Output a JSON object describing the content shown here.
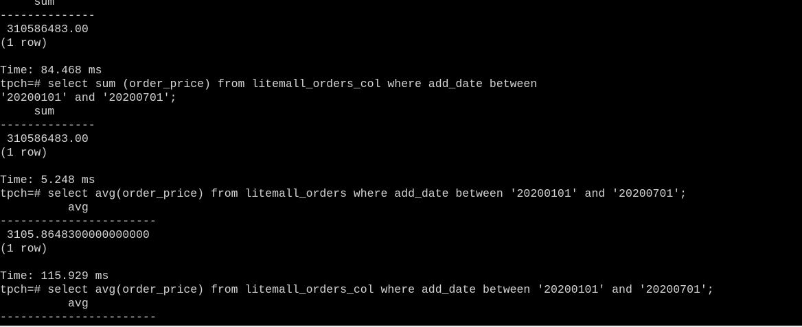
{
  "terminal": {
    "text_color": "#d4d4d4",
    "background_color": "#000000",
    "lines": [
      "     sum",
      "--------------",
      " 310586483.00",
      "(1 row)",
      "",
      "Time: 84.468 ms",
      "tpch=# select sum (order_price) from litemall_orders_col where add_date between",
      "'20200101' and '20200701';",
      "     sum",
      "--------------",
      " 310586483.00",
      "(1 row)",
      "",
      "Time: 5.248 ms",
      "tpch=# select avg(order_price) from litemall_orders where add_date between '20200101' and '20200701';",
      "          avg",
      "-----------------------",
      " 3105.8648300000000000",
      "(1 row)",
      "",
      "Time: 115.929 ms",
      "tpch=# select avg(order_price) from litemall_orders_col where add_date between '20200101' and '20200701';",
      "          avg",
      "-----------------------"
    ]
  }
}
